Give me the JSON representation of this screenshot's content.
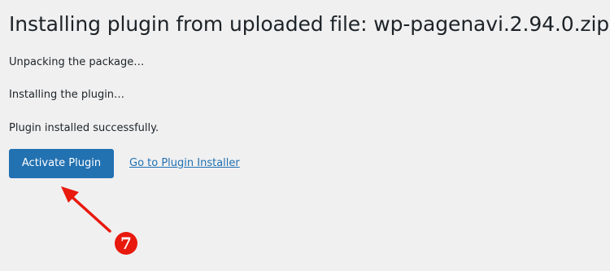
{
  "header": {
    "title": "Installing plugin from uploaded file: wp-pagenavi.2.94.0.zip"
  },
  "messages": [
    "Unpacking the package…",
    "Installing the plugin…",
    "Plugin installed successfully."
  ],
  "actions": {
    "activate_label": "Activate Plugin",
    "installer_link_label": "Go to Plugin Installer"
  },
  "annotation": {
    "step_number": "7",
    "color": "#e8190d"
  },
  "colors": {
    "background": "#f0f0f1",
    "primary": "#2271b1",
    "text": "#1d2327"
  }
}
